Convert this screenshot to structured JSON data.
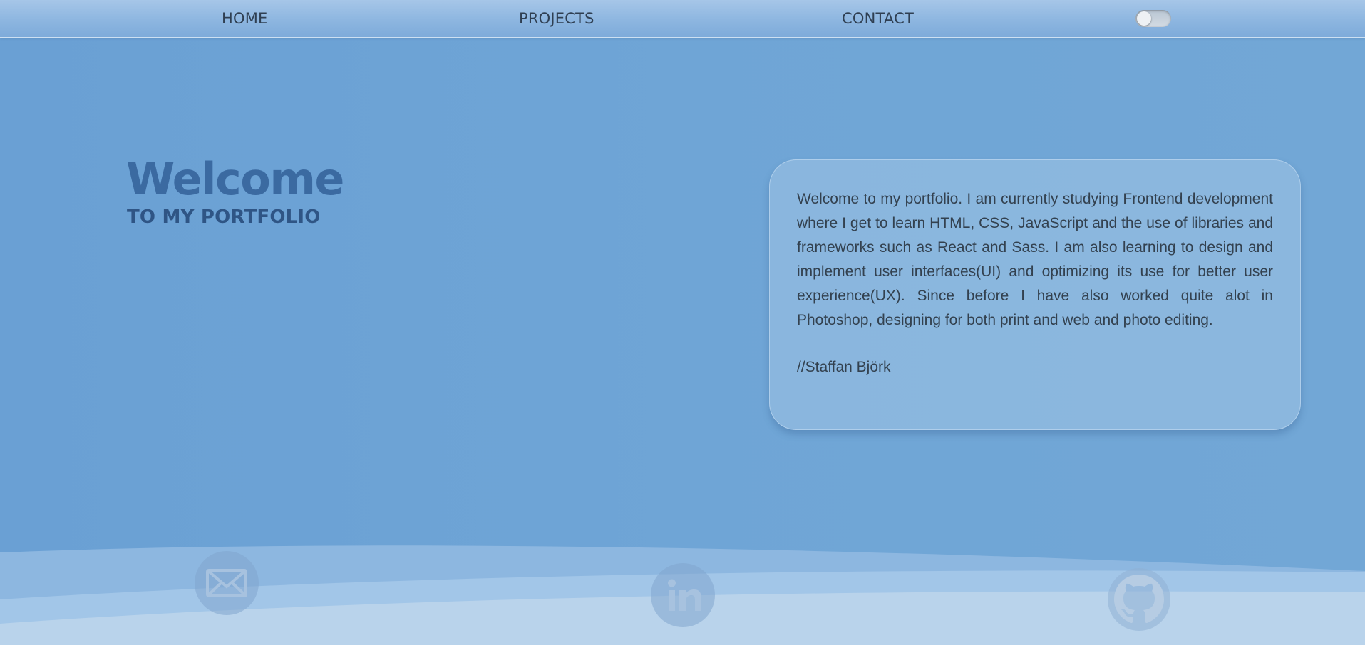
{
  "nav": {
    "home": "HOME",
    "projects": "PROJECTS",
    "contact": "CONTACT",
    "theme_toggle": {
      "on": false
    }
  },
  "hero": {
    "title": "Welcome",
    "subtitle": "TO MY PORTFOLIO"
  },
  "card": {
    "text": "Welcome to my portfolio. I am currently studying Frontend development where I get to learn HTML, CSS, JavaScript and the use of libraries and frameworks such as React and Sass. I am also learning to design and implement user interfaces(UI) and optimizing its use for better user experience(UX). Since before I have also worked quite alot in Photoshop, designing for both print and web and photo editing.",
    "signature": "//Staffan Björk"
  },
  "social": {
    "icons": [
      "mail-icon",
      "linkedin-icon",
      "github-icon"
    ]
  },
  "colors": {
    "background": "#6fa5d6",
    "title": "#3b6aa1",
    "subtitle": "#2f5585",
    "text": "#33414f"
  }
}
